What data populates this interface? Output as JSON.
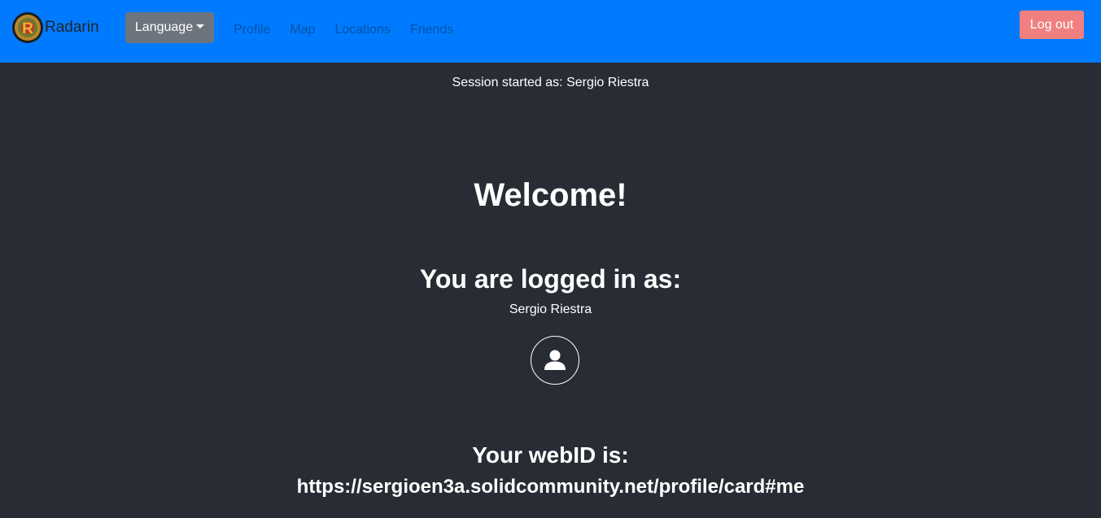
{
  "navbar": {
    "brand": "Radarin",
    "logo_icon": "radarin-logo-icon",
    "language_label": "Language",
    "links": [
      "Profile",
      "Map",
      "Locations",
      "Friends"
    ],
    "logout_label": "Log out",
    "colors": {
      "bar": "#007bff",
      "language_button": "#6c757d",
      "logout_button": "#f08080",
      "link": "#0353a8"
    }
  },
  "main": {
    "session_text": "Session started as: Sergio Riestra",
    "welcome": "Welcome!",
    "logged_in_title": "You are logged in as:",
    "user_name": "Sergio Riestra",
    "avatar_icon": "user-icon",
    "webid_title": "Your webID is:",
    "webid_url": "https://sergioen3a.solidcommunity.net/profile/card#me",
    "colors": {
      "background": "#282c34",
      "text": "#ffffff"
    }
  }
}
